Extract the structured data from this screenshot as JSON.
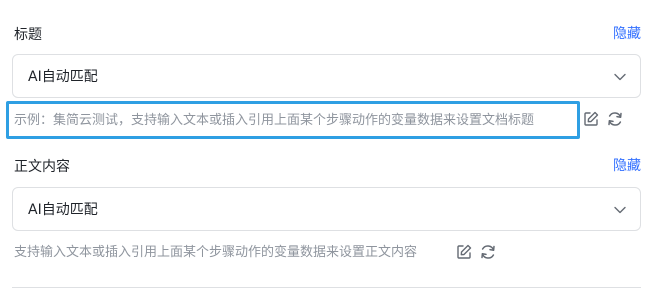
{
  "title_field": {
    "label": "标题",
    "hide_link": "隐藏",
    "select_value": "AI自动匹配",
    "hint": "示例：集简云测试，支持输入文本或插入引用上面某个步骤动作的变量数据来设置文档标题",
    "icons": [
      "edit-icon",
      "refresh-icon"
    ]
  },
  "body_field": {
    "label": "正文内容",
    "hide_link": "隐藏",
    "select_value": "AI自动匹配",
    "hint": "支持输入文本或插入引用上面某个步骤动作的变量数据来设置正文内容",
    "icons": [
      "edit-icon",
      "refresh-icon"
    ]
  },
  "colors": {
    "accent": "#3370ff",
    "focus_border": "#2f9fe3",
    "hint_text": "#8f959e",
    "border": "#dee0e3"
  }
}
